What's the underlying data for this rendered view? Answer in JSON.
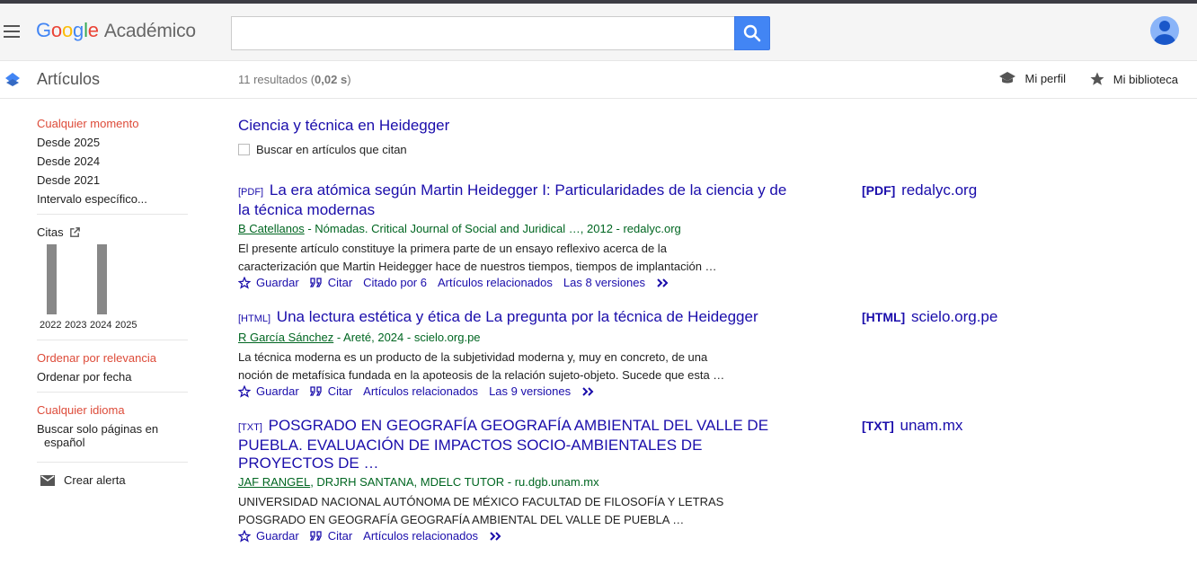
{
  "header": {
    "logo_google": [
      "G",
      "o",
      "o",
      "g",
      "l",
      "e"
    ],
    "logo_product": "Académico",
    "search_value": ""
  },
  "subbar": {
    "section": "Artículos",
    "results_count": "11 resultados",
    "results_time_prefix": " (",
    "results_time": "0,02 s",
    "results_time_suffix": ")",
    "profile": "Mi perfil",
    "library": "Mi biblioteca"
  },
  "sidebar": {
    "time_filters": [
      "Cualquier momento",
      "Desde 2025",
      "Desde 2024",
      "Desde 2021",
      "Intervalo específico..."
    ],
    "citations_label": "Citas",
    "citations_chart": {
      "years": [
        "2022",
        "2023",
        "2024",
        "2025"
      ],
      "values": [
        1,
        0,
        1,
        0
      ]
    },
    "sort": [
      "Ordenar por relevancia",
      "Ordenar por fecha"
    ],
    "language": [
      "Cualquier idioma",
      "Buscar solo páginas en",
      "español"
    ],
    "alert": "Crear alerta"
  },
  "main": {
    "query_title": "Ciencia y técnica en Heidegger",
    "cited_checkbox": "Buscar en artículos que citan",
    "results": [
      {
        "tag": "[PDF]",
        "title": "La era atómica según Martin Heidegger I: Particularidades de la ciencia y de la técnica modernas",
        "author": "B Catellanos",
        "meta": " - Nómadas. Critical Journal of Social and Juridical …, 2012 - redalyc.org",
        "snippet": "El presente artículo constituye la primera parte de un ensayo reflexivo acerca de la caracterización que Martin Heidegger hace de nuestros tiempos, tiempos de implantación …",
        "save": "Guardar",
        "cite": "Citar",
        "cited_by": "Citado por 6",
        "related": "Artículos relacionados",
        "versions": "Las 8 versiones",
        "side_tag": "[PDF]",
        "side_source": "redalyc.org"
      },
      {
        "tag": "[HTML]",
        "title": "Una lectura estética y ética de La pregunta por la técnica de Heidegger",
        "author": "R García Sánchez",
        "meta": " - Areté, 2024 - scielo.org.pe",
        "snippet": "La técnica moderna es un producto de la subjetividad moderna y, muy en concreto, de una noción de metafísica fundada en la apoteosis de la relación sujeto-objeto. Sucede que esta …",
        "save": "Guardar",
        "cite": "Citar",
        "related": "Artículos relacionados",
        "versions": "Las 9 versiones",
        "side_tag": "[HTML]",
        "side_source": "scielo.org.pe"
      },
      {
        "tag": "[TXT]",
        "title": "POSGRADO EN GEOGRAFÍA GEOGRAFÍA AMBIENTAL DEL VALLE DE PUEBLA. EVALUACIÓN DE IMPACTOS SOCIO-AMBIENTALES DE PROYECTOS DE …",
        "author": "JAF RANGEL",
        "meta": ", DRJRH SANTANA, MDELC TUTOR - ru.dgb.unam.mx",
        "snippet": "UNIVERSIDAD NACIONAL AUTÓNOMA DE MÉXICO FACULTAD DE FILOSOFÍA Y LETRAS POSGRADO EN GEOGRAFÍA GEOGRAFÍA AMBIENTAL DEL VALLE DE PUEBLA …",
        "save": "Guardar",
        "cite": "Citar",
        "related": "Artículos relacionados",
        "side_tag": "[TXT]",
        "side_source": "unam.mx"
      }
    ]
  },
  "colors": {
    "link": "#1a0dab",
    "green": "#006621",
    "red_filter": "#dd4b39",
    "search_button": "#4285f4"
  }
}
